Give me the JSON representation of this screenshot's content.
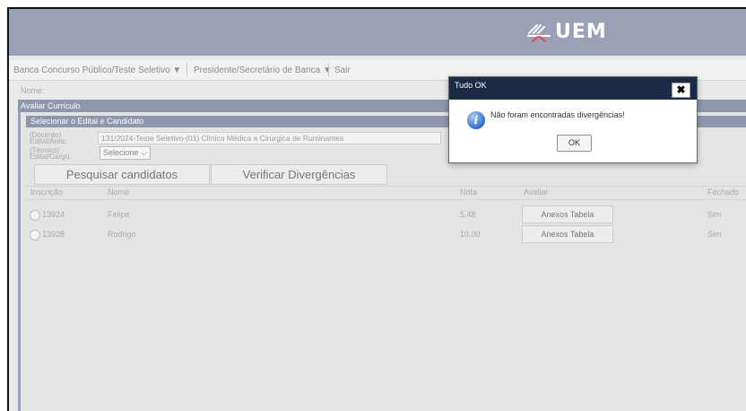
{
  "banner": {
    "logo_text": "UEM"
  },
  "menu": {
    "items": [
      "Banca Concurso Público/Teste Seletivo",
      "Presidente/Secretário de Banca",
      "Sair"
    ],
    "caret": "▼"
  },
  "nome_label": "Nome:",
  "panel": {
    "title": "Avaliar Currículo",
    "section_title": "Selecionar o Edital e Candidato",
    "docente_label": "(Docente)",
    "edital_area_label": "Edital/Área:",
    "edital_value": "131/2024-Teste Seletivo-(01) Clínica Médica e Cirúrgica de Ruminantes",
    "tecnico_label": "(Técnico)",
    "edital_cargo_label": "Edital/Cargo:",
    "cargo_select": "Selecione",
    "cargo_select_arrow": "⌵",
    "search_button": "Pesquisar candidatos",
    "verify_button": "Verificar Divergências"
  },
  "table": {
    "headers": [
      "Inscrição",
      "Nome",
      "Nota",
      "Avaliar",
      "Fechado"
    ],
    "rows": [
      {
        "inscricao": "13924",
        "nome": "Felipe",
        "nota": "5.48",
        "avaliar": "Anexos Tabela",
        "fechado": "Sim"
      },
      {
        "inscricao": "13928",
        "nome": "Rodrigo",
        "nota": "10.00",
        "avaliar": "Anexos Tabela",
        "fechado": "Sim"
      }
    ]
  },
  "dialog": {
    "title": "Tudo OK",
    "close_glyph": "✖",
    "message": "Não foram encontradas divergências!",
    "ok": "OK",
    "icon_glyph": "i"
  },
  "colors": {
    "banner": "#9aa0b6",
    "panel_header": "#8e97ab",
    "dialog_title": "#1b2a45"
  }
}
